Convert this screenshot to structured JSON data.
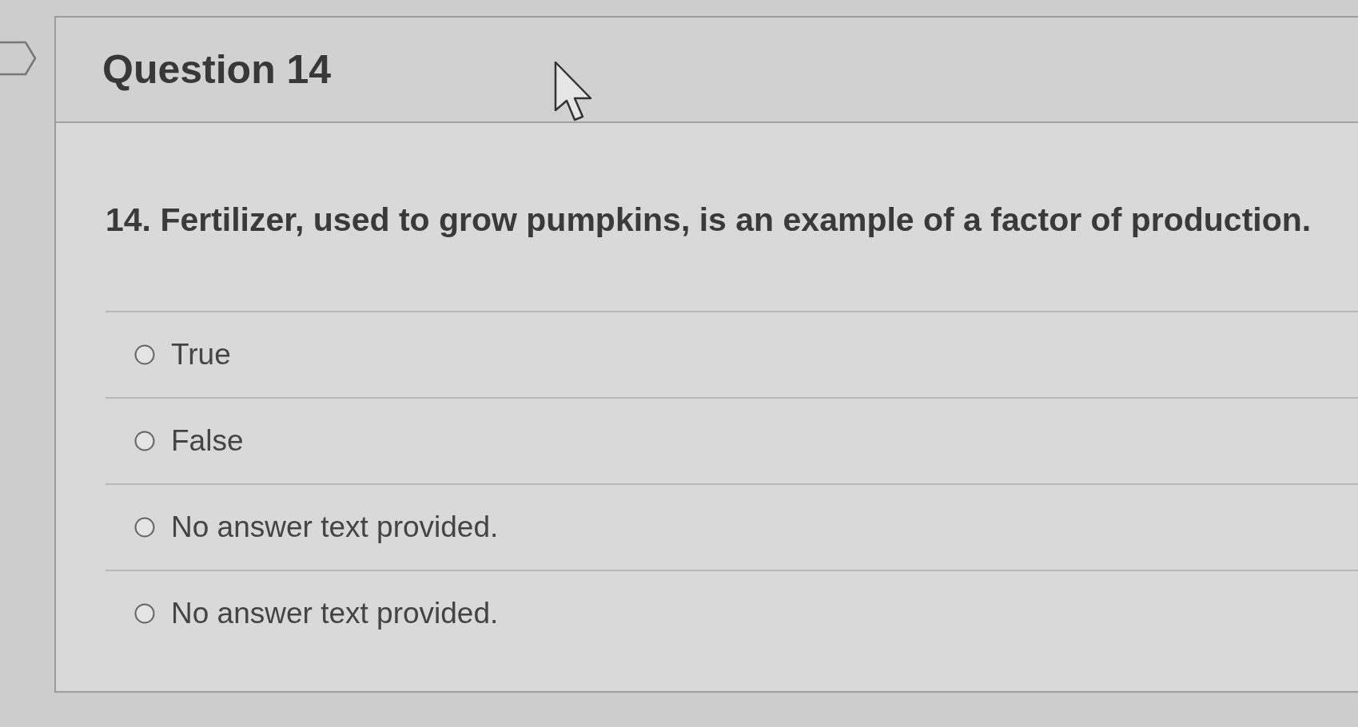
{
  "question": {
    "title": "Question 14",
    "text": "14. Fertilizer, used to grow pumpkins, is an example of a factor of production.",
    "answers": [
      {
        "label": "True",
        "selected": false
      },
      {
        "label": "False",
        "selected": false
      },
      {
        "label": "No answer text provided.",
        "selected": false
      },
      {
        "label": "No answer text provided.",
        "selected": false
      }
    ]
  }
}
